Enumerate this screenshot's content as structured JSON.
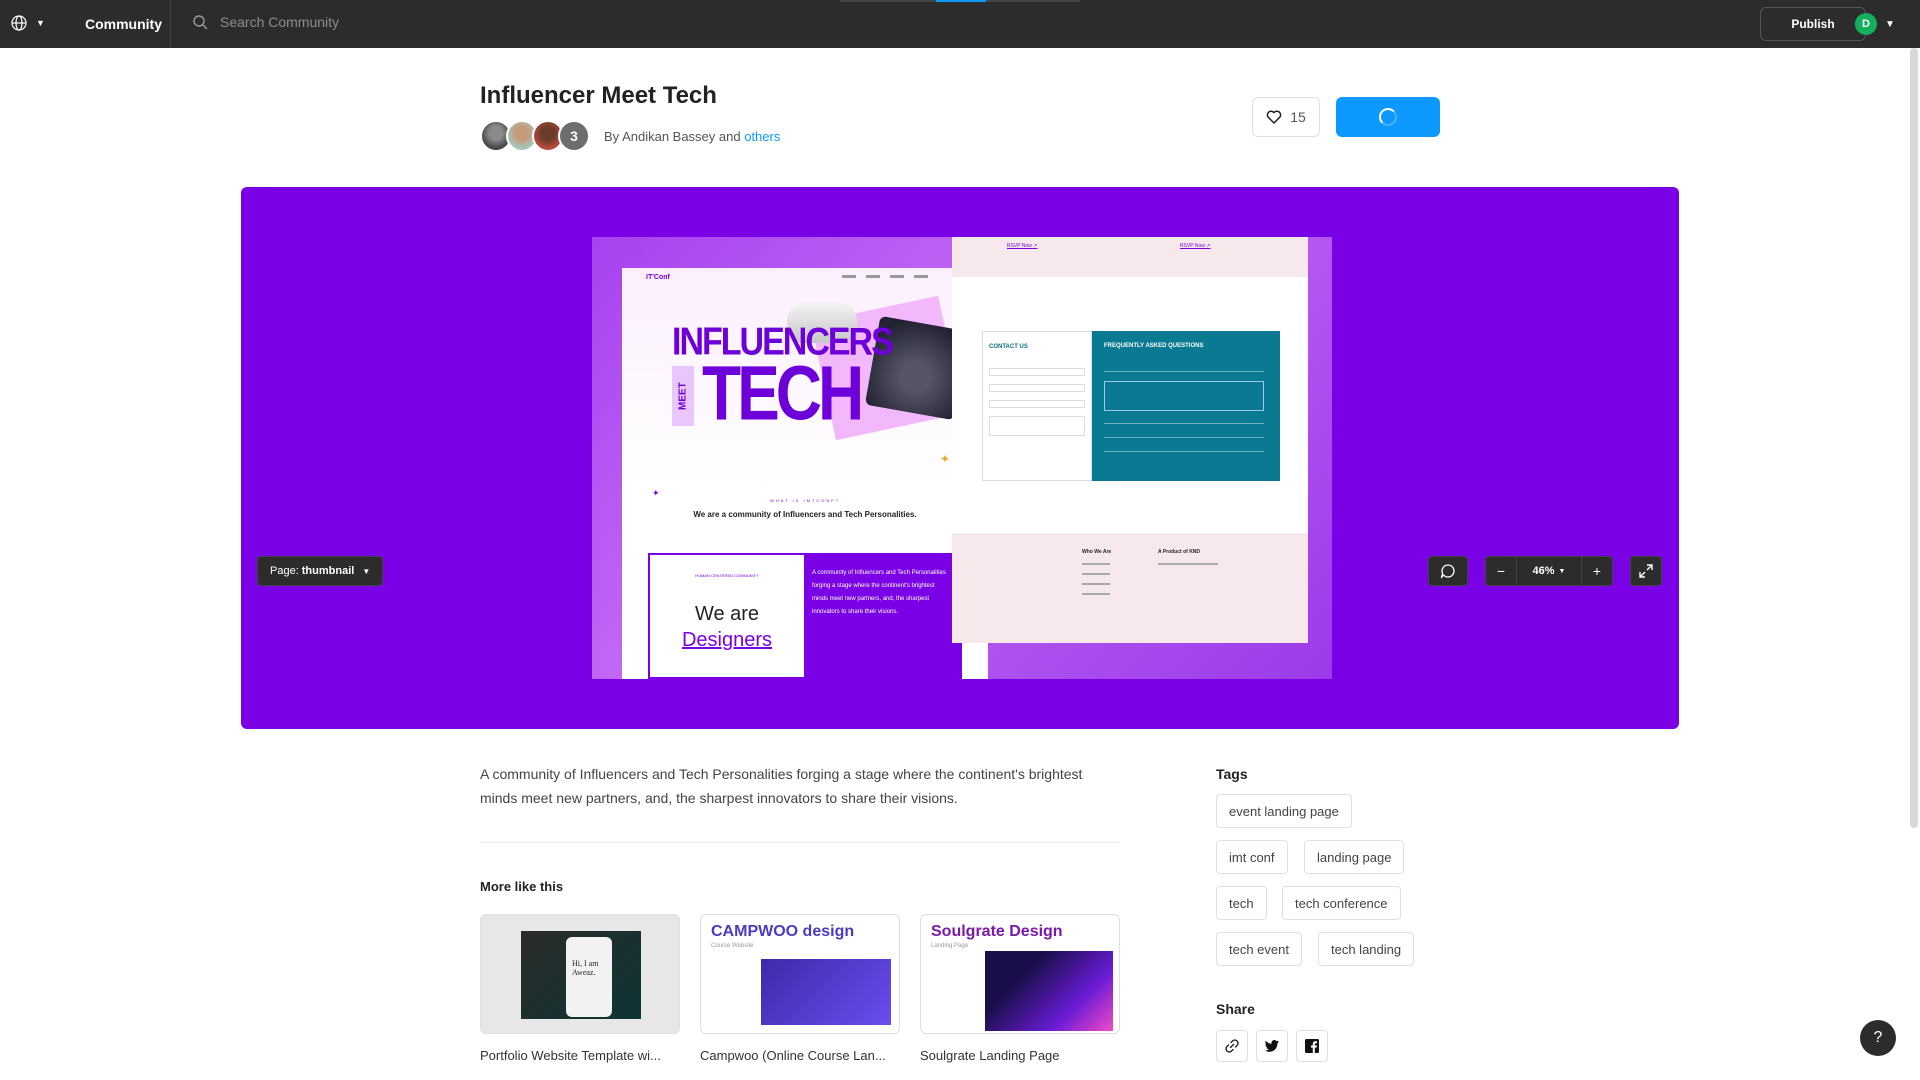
{
  "topbar": {
    "community_label": "Community",
    "search_placeholder": "Search Community",
    "publish_label": "Publish",
    "avatar_initial": "D",
    "loading_progress": 0.2
  },
  "file": {
    "title": "Influencer Meet Tech",
    "authors_extra_count": "3",
    "by_prefix": "By Andikan Bassey and",
    "others_link": "others",
    "like_count": "15"
  },
  "preview": {
    "page_label_prefix": "Page:",
    "page_name": "thumbnail",
    "zoom_minus": "−",
    "zoom_level": "46%",
    "zoom_plus": "+",
    "artboard": {
      "logo": "IT'Conf",
      "influencers": "INFLUENCERS",
      "meet": "MEET",
      "tech": "TECH",
      "what_is": "WHAT IS IMTCONF?",
      "tagline": "We are a community of Influencers and Tech Personalities.",
      "human_centered": "HUMAN CENTERED COMMUNITY",
      "we_are": "We are",
      "designers": "Designers",
      "community_blurb": "A community of Influencers and Tech Personalities forging a stage where the continent's brightest minds meet new partners, and, the sharpest innovators to share their visions.",
      "rsvp1": "RSVP Now ↗",
      "rsvp2": "RSVP Now ↗",
      "contact_us": "CONTACT US",
      "faq": "FREQUENTLY ASKED QUESTIONS",
      "who_we_are": "Who We Are",
      "product_of": "A Product of KND"
    }
  },
  "description": "A community of Influencers and Tech Personalities forging a stage where the continent's brightest minds meet new partners, and, the sharpest innovators to share their visions.",
  "more_like_this": {
    "title": "More like this",
    "items": [
      {
        "label": "Portfolio Website Template wi...",
        "screen_text": "Hi, I am Aweaz."
      },
      {
        "label": "Campwoo (Online Course Lan...",
        "heading": "CAMPWOO design",
        "sub": "Course Website"
      },
      {
        "label": "Soulgrate Landing Page",
        "heading": "Soulgrate Design",
        "sub": "Landing Page"
      }
    ]
  },
  "tags": {
    "title": "Tags",
    "items": [
      "event landing page",
      "imt conf",
      "landing page",
      "tech",
      "tech conference",
      "tech event",
      "tech landing"
    ]
  },
  "share": {
    "title": "Share"
  },
  "help_label": "?",
  "colors": {
    "accent_blue": "#0d99ff",
    "canvas_purple": "#7a00e6",
    "topbar": "#2c2c2c"
  }
}
